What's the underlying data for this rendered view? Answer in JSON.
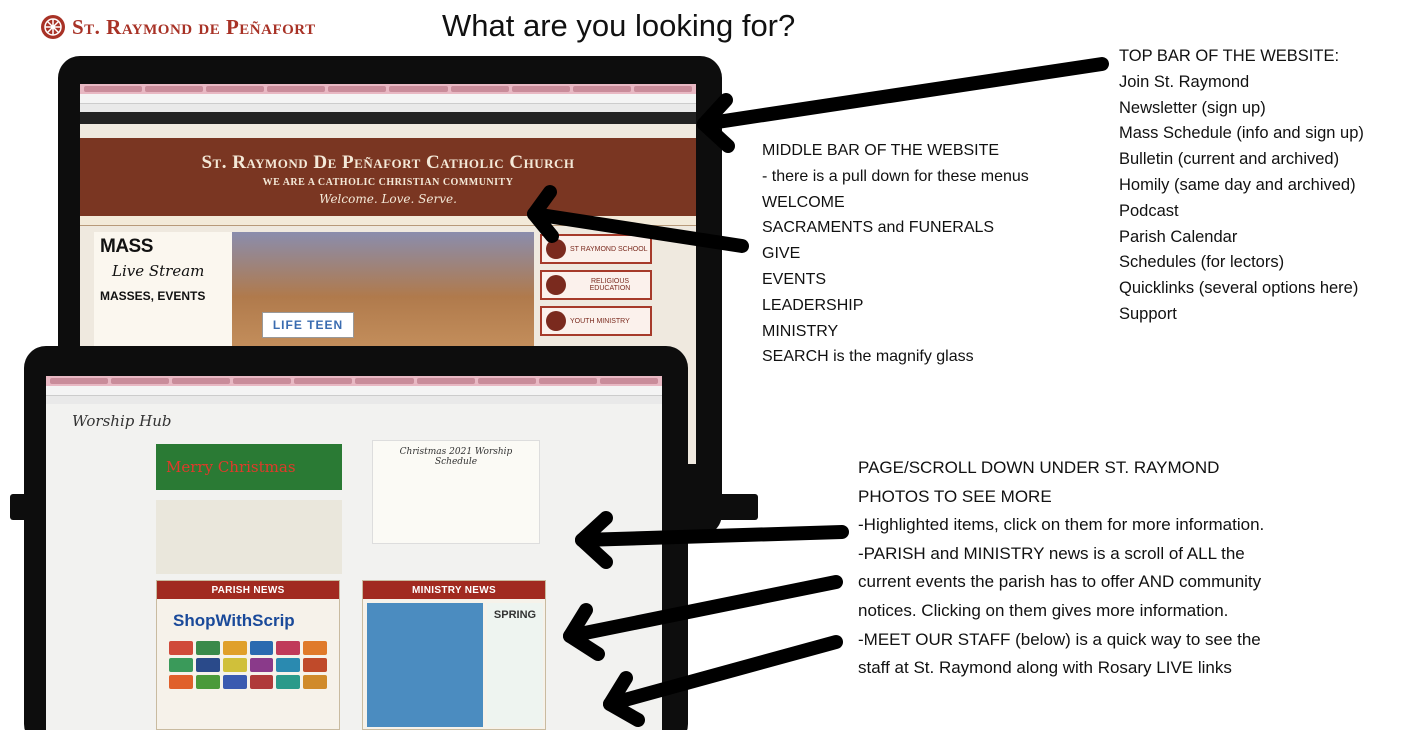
{
  "brand": {
    "name": "St. Raymond de Peñafort"
  },
  "headline": "What are you looking for?",
  "colors": {
    "brand_red": "#a83226",
    "banner_brown": "#7a3622",
    "news_red": "#a12a20",
    "laptop_black": "#0d0d0d"
  },
  "site_preview": {
    "banner_title": "St. Raymond De Peñafort Catholic Church",
    "banner_subtitle": "WE ARE A CATHOLIC CHRISTIAN COMMUNITY",
    "banner_motto": "Welcome. Love. Serve.",
    "mass_panel": {
      "title": "MASS",
      "live": "Live Stream",
      "events": "MASSES, EVENTS"
    },
    "photo_label": "LIFE TEEN",
    "side_buttons": [
      "ST RAYMOND SCHOOL",
      "RELIGIOUS EDUCATION",
      "YOUTH MINISTRY"
    ]
  },
  "site_preview_2": {
    "worship_tag": "Worship Hub",
    "christmas_card": "Merry Christmas",
    "schedule_card_title": "Christmas 2021 Worship Schedule",
    "parish_news": "PARISH NEWS",
    "ministry_news": "MINISTRY NEWS",
    "scrip": "ShopWithScrip",
    "spring": "SPRING"
  },
  "annotations": {
    "top_bar": [
      "TOP BAR OF THE WEBSITE:",
      "Join St. Raymond",
      "Newsletter (sign up)",
      "Mass Schedule (info and sign up)",
      "Bulletin (current and archived)",
      "Homily (same day and archived)",
      "Podcast",
      "Parish Calendar",
      "Schedules (for lectors)",
      "Quicklinks (several options here)",
      "Support"
    ],
    "middle_bar": [
      "MIDDLE BAR OF THE WEBSITE",
      "- there is a pull down for these menus",
      "WELCOME",
      "SACRAMENTS and FUNERALS",
      "GIVE",
      "EVENTS",
      "LEADERSHIP",
      "MINISTRY",
      "SEARCH is the magnify glass"
    ],
    "page_scroll": [
      "PAGE/SCROLL DOWN UNDER ST. RAYMOND",
      "PHOTOS TO SEE MORE",
      "-Highlighted items, click on them for more information.",
      "-PARISH and MINISTRY news is a scroll of ALL the",
      "current events the parish has to offer AND community",
      "notices.  Clicking on them gives more information.",
      "-MEET OUR STAFF (below) is a quick way to see the",
      "staff at St. Raymond along with Rosary LIVE links"
    ]
  }
}
